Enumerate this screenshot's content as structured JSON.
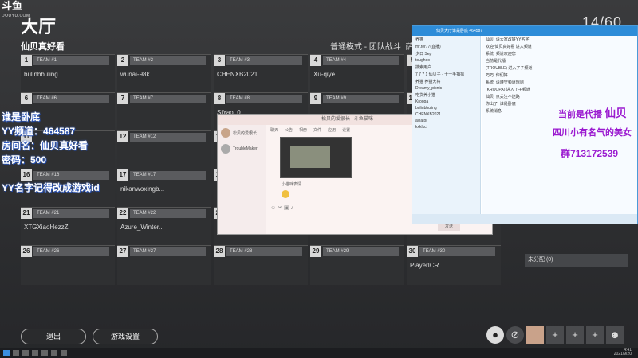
{
  "watermark": {
    "brand": "斗鱼",
    "sub": "DOUYU.COM"
  },
  "lobby": {
    "title": "大厅",
    "room_name": "仙贝真好看",
    "mode": "普通模式 - 团队战斗",
    "mode_extra": "萨",
    "counter": "14/60"
  },
  "slots": [
    {
      "num": "1",
      "team": "TEAM #1",
      "player": "bulinbbuling"
    },
    {
      "num": "2",
      "team": "TEAM #2",
      "player": "wunai-98k"
    },
    {
      "num": "3",
      "team": "TEAM #3",
      "player": "CHENXB2021"
    },
    {
      "num": "4",
      "team": "TEAM #4",
      "player": "Xu-qiye"
    },
    {
      "num": "5",
      "team": "",
      "player": ""
    },
    {
      "num": "6",
      "team": "TEAM #6",
      "player": ""
    },
    {
      "num": "7",
      "team": "TEAM #7",
      "player": ""
    },
    {
      "num": "8",
      "team": "TEAM #8",
      "player": "SiYao_0"
    },
    {
      "num": "9",
      "team": "TEAM #9",
      "player": ""
    },
    {
      "num": "10",
      "team": "",
      "player": ""
    },
    {
      "num": "11",
      "team": "",
      "player": ""
    },
    {
      "num": "12",
      "team": "TEAM #12",
      "player": ""
    },
    {
      "num": "13",
      "team": "",
      "player": ""
    },
    {
      "num": "14",
      "team": "",
      "player": ""
    },
    {
      "num": "15",
      "team": "",
      "player": ""
    },
    {
      "num": "16",
      "team": "TEAM #16",
      "player": ""
    },
    {
      "num": "17",
      "team": "TEAM #17",
      "player": "nikanwoxingb..."
    },
    {
      "num": "18",
      "team": "",
      "player": ""
    },
    {
      "num": "19",
      "team": "",
      "player": ""
    },
    {
      "num": "20",
      "team": "",
      "player": ""
    },
    {
      "num": "21",
      "team": "TEAM #21",
      "player": "XTGXiaoHezzZ"
    },
    {
      "num": "22",
      "team": "TEAM #22",
      "player": "Azure_Winter..."
    },
    {
      "num": "23",
      "team": "",
      "player": ""
    },
    {
      "num": "24",
      "team": "",
      "player": ""
    },
    {
      "num": "25",
      "team": "",
      "player": ""
    },
    {
      "num": "26",
      "team": "TEAM #26",
      "player": ""
    },
    {
      "num": "27",
      "team": "TEAM #27",
      "player": ""
    },
    {
      "num": "28",
      "team": "TEAM #28",
      "player": ""
    },
    {
      "num": "29",
      "team": "TEAM #29",
      "player": ""
    },
    {
      "num": "30",
      "team": "TEAM #30",
      "player": "PlayerICR"
    }
  ],
  "overlay": {
    "line1": "谁是卧底",
    "line2": "YY频道：464587",
    "line3": "房间名：仙贝真好看",
    "line4": "密码：500",
    "line5": "YY名字记得改成游戏id"
  },
  "buttons": {
    "exit": "退出",
    "settings": "游戏设置"
  },
  "unassigned": "未分配 (0)",
  "chat": {
    "title": "松贝的爱很长 | 斗鱼猫咪",
    "contact1": "松贝的爱很长",
    "contact2": "TroubleMaker",
    "tabs": [
      "聊天",
      "公告",
      "相册",
      "文件",
      "应用",
      "设置"
    ],
    "file": "小猫咪表情"
  },
  "yy": {
    "title": "仙贝大厅谁是卧底 464587",
    "left": [
      "养猫",
      "mr.ter77(直播)",
      "夕日 Sep",
      "toughoo",
      "搜索用户",
      "7 7 7 1 仙贝子 - 十一手捕探",
      "养猫 养猫大将",
      "Dreamy_picnic",
      "吃货养小猫",
      "Kroopa",
      "bulinbbuling",
      "CHENXB2021",
      "aviator",
      "kxklkcl"
    ],
    "right": [
      "仙贝: 请大家改好YY名字",
      "欢迎 仙贝真好看 进入频道",
      "系统: 频道欢迎您",
      "当前是代播",
      "(TROUBLE) 进入了子频道",
      "巧巧: 你们好",
      "系统: 请遵守频道规则",
      "(KROOPA) 进入了子频道",
      "仙贝: 点关注不迷路",
      "你出了: 谁是卧底",
      "系统消息"
    ]
  },
  "promo": {
    "now": "当前是代播",
    "name": "仙贝",
    "desc": "四川小有名气的美女",
    "group": "群713172539"
  },
  "taskbar": {
    "time": "4:41",
    "date": "2021/9/20"
  }
}
